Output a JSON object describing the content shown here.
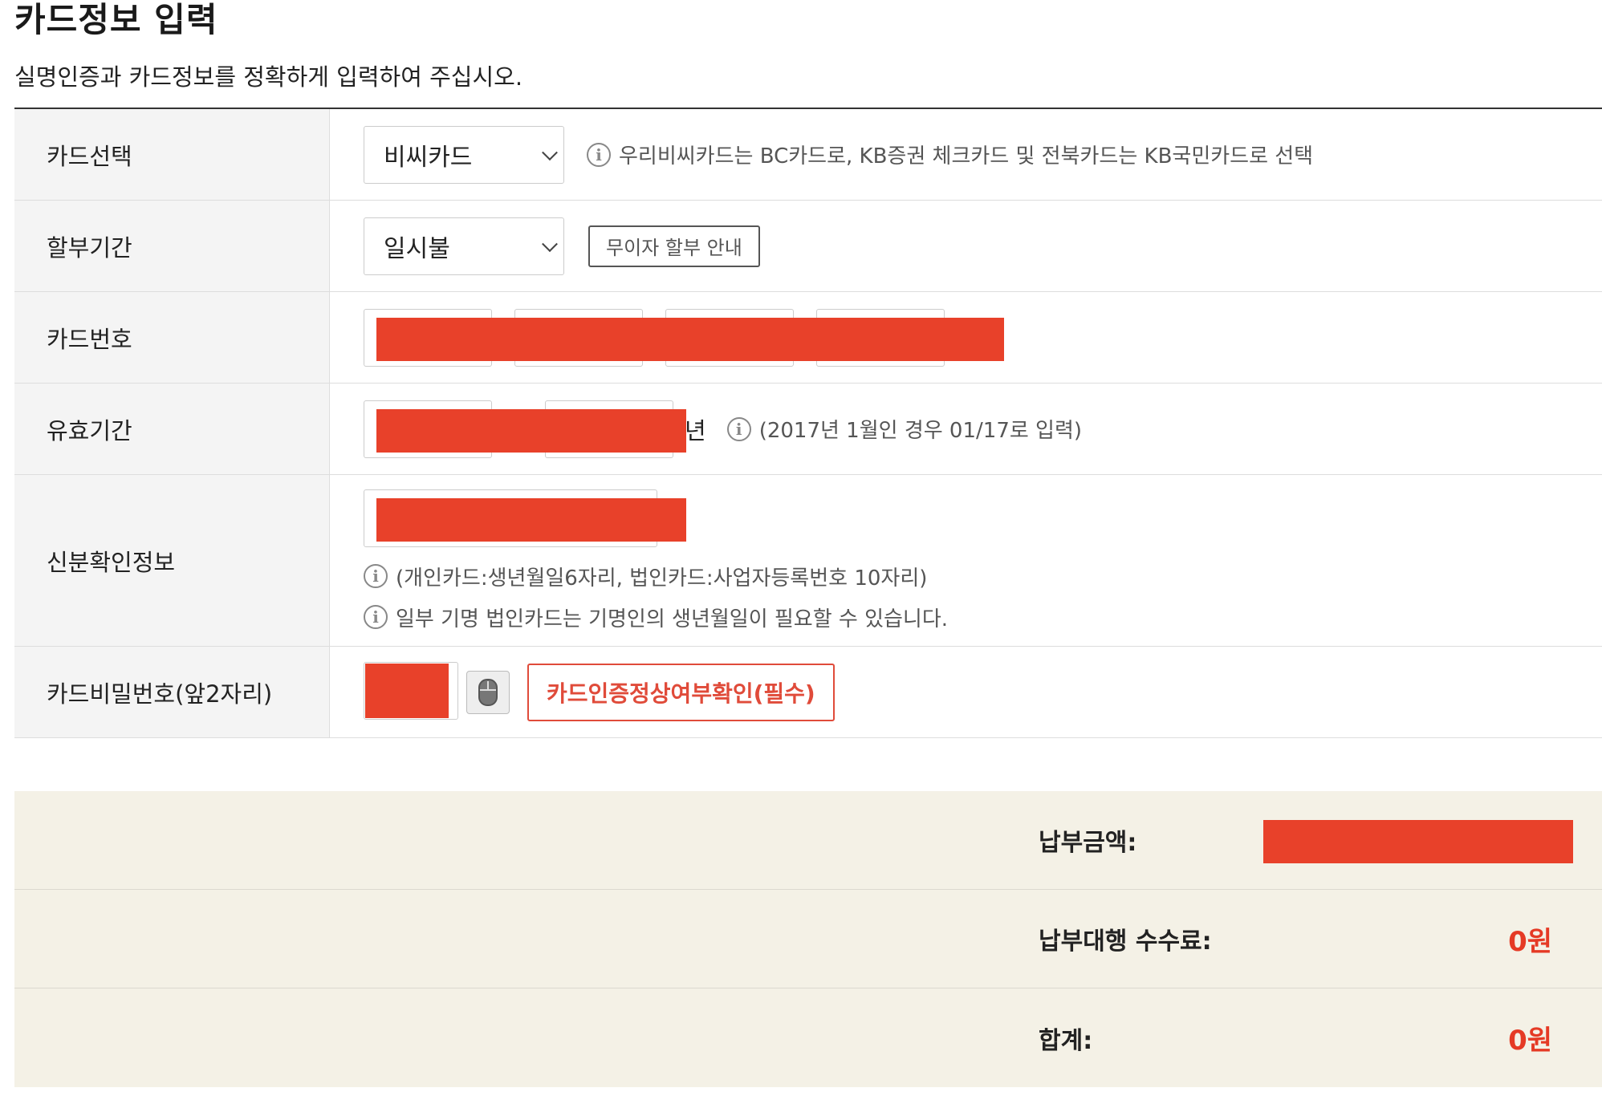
{
  "header": {
    "title": "카드정보 입력",
    "description": "실명인증과 카드정보를 정확하게 입력하여 주십시오."
  },
  "form": {
    "card_select": {
      "label": "카드선택",
      "selected": "비씨카드",
      "note": "우리비씨카드는 BC카드로, KB증권 체크카드 및 전북카드는 KB국민카드로 선택"
    },
    "installment": {
      "label": "할부기간",
      "selected": "일시불",
      "button": "무이자 할부 안내"
    },
    "card_number": {
      "label": "카드번호"
    },
    "expiry": {
      "label": "유효기간",
      "suffix": "년",
      "note": "(2017년 1월인 경우 01/17로 입력)"
    },
    "identity": {
      "label": "신분확인정보",
      "note1": "(개인카드:생년월일6자리, 법인카드:사업자등록번호 10자리)",
      "note2": "일부 기명 법인카드는 기명인의 생년월일이 필요할 수 있습니다."
    },
    "password": {
      "label": "카드비밀번호(앞2자리)",
      "button": "카드인증정상여부확인(필수)"
    }
  },
  "summary": {
    "amount_label": "납부금액:",
    "fee_label": "납부대행 수수료:",
    "fee_value": "0원",
    "total_label": "합계:",
    "total_value": "0원"
  },
  "colors": {
    "accent": "#e53a25",
    "redaction": "#e8412a",
    "summary_bg": "#f4f1e6"
  }
}
